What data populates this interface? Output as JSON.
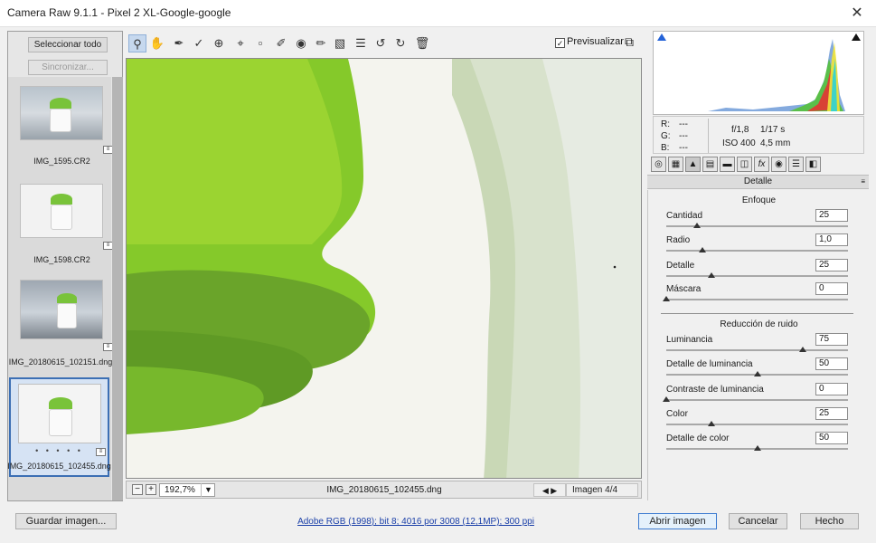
{
  "window": {
    "title": "Camera Raw 9.1.1 -  Pixel 2 XL-Google-google",
    "close_glyph": "✕"
  },
  "filmstrip": {
    "select_all": "Seleccionar todo",
    "sync": "Sincronizar...",
    "items": [
      {
        "label": "IMG_1595.CR2"
      },
      {
        "label": "IMG_1598.CR2"
      },
      {
        "label": "IMG_20180615_102151.dng"
      },
      {
        "label": "IMG_20180615_102455.dng",
        "rating": "• • • • •"
      }
    ]
  },
  "toolbar": {
    "tools": [
      "zoom-tool-icon",
      "hand-tool-icon",
      "white-balance-icon",
      "color-sampler-icon",
      "targeted-adjust-icon",
      "crop-icon",
      "straighten-icon",
      "spot-removal-icon",
      "red-eye-icon",
      "adjustment-brush-icon",
      "graduated-filter-icon",
      "preferences-icon",
      "rotate-left-icon",
      "rotate-right-icon",
      "trash-icon"
    ],
    "preview_label": "Previsualizar",
    "preview_checked": "✓"
  },
  "canvas_bar": {
    "zoom_out": "−",
    "zoom_in": "+",
    "zoom": "192,7%",
    "filename": "IMG_20180615_102455.dng",
    "prev_next": "◀ ▶",
    "image_count": "Imagen 4/4"
  },
  "info": {
    "r_label": "R:",
    "r_val": "---",
    "g_label": "G:",
    "g_val": "---",
    "b_label": "B:",
    "b_val": "---",
    "aperture": "f/1,8",
    "shutter": "1/17 s",
    "iso": "ISO 400",
    "focal": "4,5 mm"
  },
  "panel": {
    "title": "Detalle",
    "sharpen_title": "Enfoque",
    "noise_title": "Reducción de ruido",
    "sharpen": [
      {
        "label": "Cantidad",
        "value": "25",
        "level": 0.17
      },
      {
        "label": "Radio",
        "value": "1,0",
        "level": 0.2
      },
      {
        "label": "Detalle",
        "value": "25",
        "level": 0.25
      },
      {
        "label": "Máscara",
        "value": "0",
        "level": 0.0
      }
    ],
    "noise": [
      {
        "label": "Luminancia",
        "value": "75",
        "level": 0.75
      },
      {
        "label": "Detalle de luminancia",
        "value": "50",
        "level": 0.5
      },
      {
        "label": "Contraste de luminancia",
        "value": "0",
        "level": 0.0
      },
      {
        "label": "Color",
        "value": "25",
        "level": 0.25
      },
      {
        "label": "Detalle de color",
        "value": "50",
        "level": 0.5
      }
    ]
  },
  "footer": {
    "save": "Guardar imagen...",
    "workflow": "Adobe RGB (1998); bit 8; 4016 por 3008 (12,1MP); 300 ppi",
    "open": "Abrir imagen",
    "cancel": "Cancelar",
    "done": "Hecho"
  },
  "colors": {
    "accent": "#3c6fb4",
    "green": "#7cc520"
  }
}
